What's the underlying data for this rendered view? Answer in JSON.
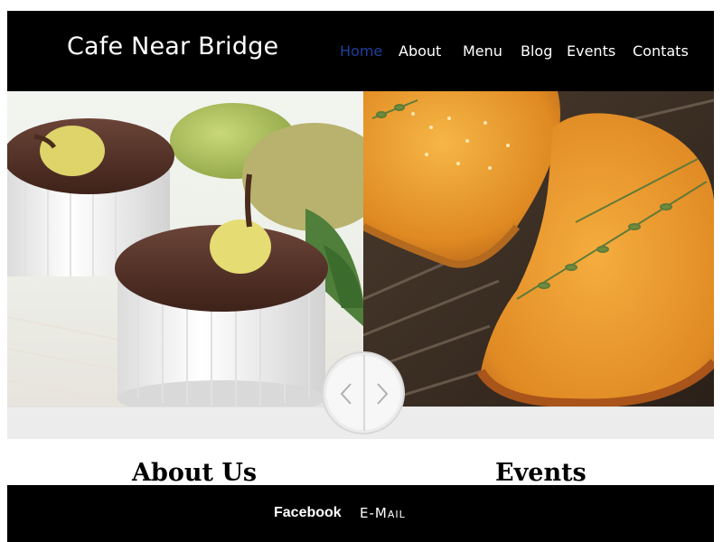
{
  "header": {
    "brand": "Cafe Near Bridge",
    "nav": [
      {
        "label": "Home",
        "active": true
      },
      {
        "label": "About",
        "active": false
      },
      {
        "label": "Menu",
        "active": false
      },
      {
        "label": "Blog",
        "active": false
      },
      {
        "label": "Events",
        "active": false
      },
      {
        "label": "Contats",
        "active": false
      }
    ]
  },
  "slider": {
    "left_image": "chocolate-pear-souffle-photo",
    "right_image": "baked-pastry-with-thyme-photo",
    "prev_icon": "chevron-left-icon",
    "next_icon": "chevron-right-icon"
  },
  "sections": {
    "about_heading": "About Us",
    "events_heading": "Events"
  },
  "footer": {
    "facebook": "Facebook",
    "email": "E-Mail"
  },
  "colors": {
    "header_bg": "#000000",
    "nav_active": "#1f3f9e",
    "nav_text": "#ffffff",
    "footer_bg": "#000000"
  }
}
